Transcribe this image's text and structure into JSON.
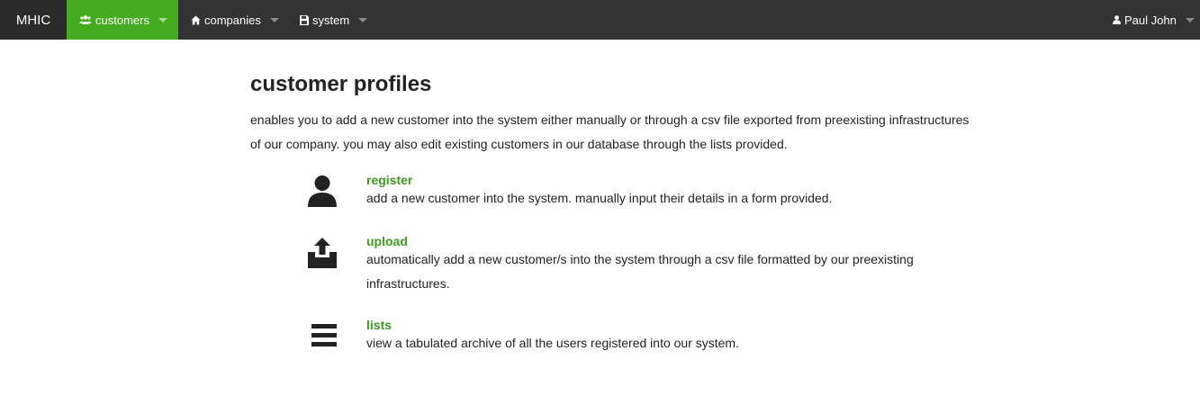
{
  "navbar": {
    "brand": "MHIC",
    "items": [
      {
        "label": "customers",
        "icon": "group-icon",
        "active": true
      },
      {
        "label": "companies",
        "icon": "home-icon",
        "active": false
      },
      {
        "label": "system",
        "icon": "save-icon",
        "active": false
      }
    ],
    "user": {
      "label": "Paul John",
      "icon": "user-icon"
    }
  },
  "main": {
    "title": "customer profiles",
    "intro": "enables you to add a new customer into the system either manually or through a csv file exported from preexisting infrastructures of our company. you may also edit existing customers in our database through the lists provided.",
    "features": [
      {
        "title": "register",
        "description": "add a new customer into the system. manually input their details in a form provided.",
        "icon": "user-icon"
      },
      {
        "title": "upload",
        "description": "automatically add a new customer/s into the system through a csv file formatted by our preexisting infrastructures.",
        "icon": "upload-icon"
      },
      {
        "title": "lists",
        "description": "view a tabulated archive of all the users registered into our system.",
        "icon": "list-icon"
      }
    ]
  },
  "colors": {
    "navbar_bg": "#333333",
    "active_nav": "#43ac1f",
    "link_green": "#3e9c1d"
  }
}
